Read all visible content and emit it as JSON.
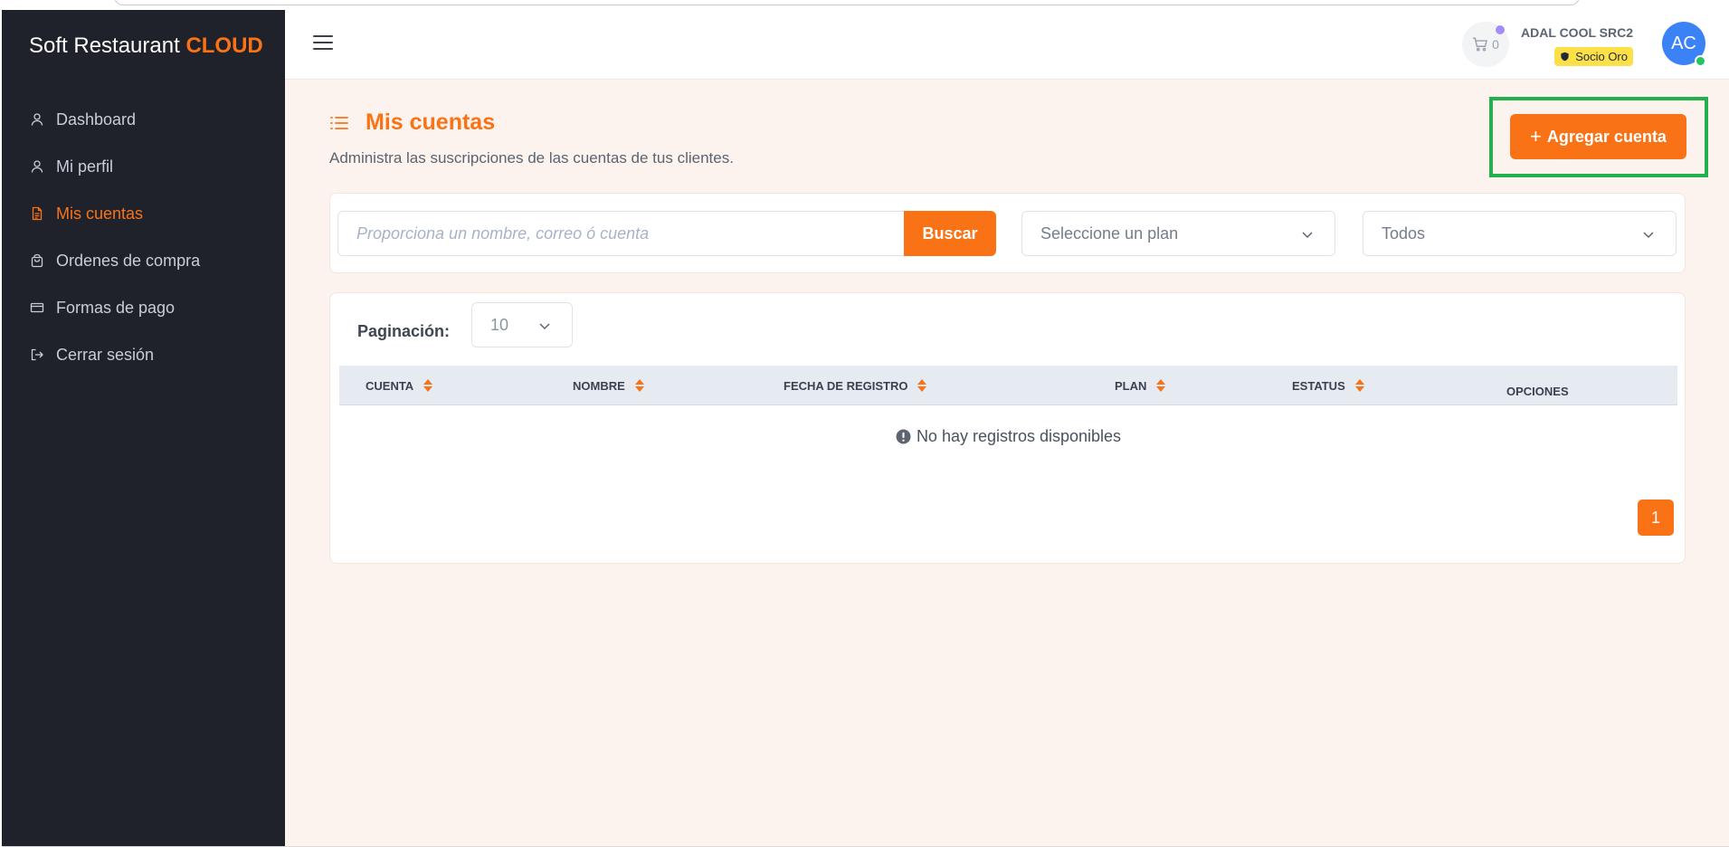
{
  "app": {
    "brand_main": "Soft Restaurant ",
    "brand_accent": "CLOUD"
  },
  "sidebar": {
    "items": [
      {
        "label": "Dashboard",
        "icon": "user-icon",
        "active": false
      },
      {
        "label": "Mi perfil",
        "icon": "user-icon",
        "active": false
      },
      {
        "label": "Mis cuentas",
        "icon": "document-icon",
        "active": true
      },
      {
        "label": "Ordenes de compra",
        "icon": "shopping-bag-icon",
        "active": false
      },
      {
        "label": "Formas de pago",
        "icon": "credit-card-icon",
        "active": false
      },
      {
        "label": "Cerrar sesión",
        "icon": "logout-icon",
        "active": false
      }
    ]
  },
  "topbar": {
    "cart_count": "0",
    "user_name": "ADAL COOL SRC2",
    "user_badge": "Socio Oro",
    "avatar_initials": "AC"
  },
  "page": {
    "title": "Mis cuentas",
    "subtitle": "Administra las suscripciones de las cuentas de tus clientes.",
    "add_button": "Agregar cuenta",
    "add_button_prefix": "+"
  },
  "filters": {
    "search_placeholder": "Proporciona un nombre, correo ó cuenta",
    "search_value": "",
    "search_button": "Buscar",
    "plan_select": "Seleccione un plan",
    "status_select": "Todos"
  },
  "table": {
    "pagination_label": "Paginación:",
    "page_size": "10",
    "columns": [
      "CUENTA",
      "NOMBRE",
      "FECHA DE REGISTRO",
      "PLAN",
      "ESTATUS",
      "OPCIONES"
    ],
    "empty_message": "No hay registros disponibles",
    "current_page": "1"
  },
  "colors": {
    "accent": "#f97316",
    "sidebar_bg": "#1f222a",
    "content_bg": "#fdf3ee",
    "badge_bg": "#fde047",
    "avatar_bg": "#3b82f6",
    "highlight": "#22b14c"
  }
}
